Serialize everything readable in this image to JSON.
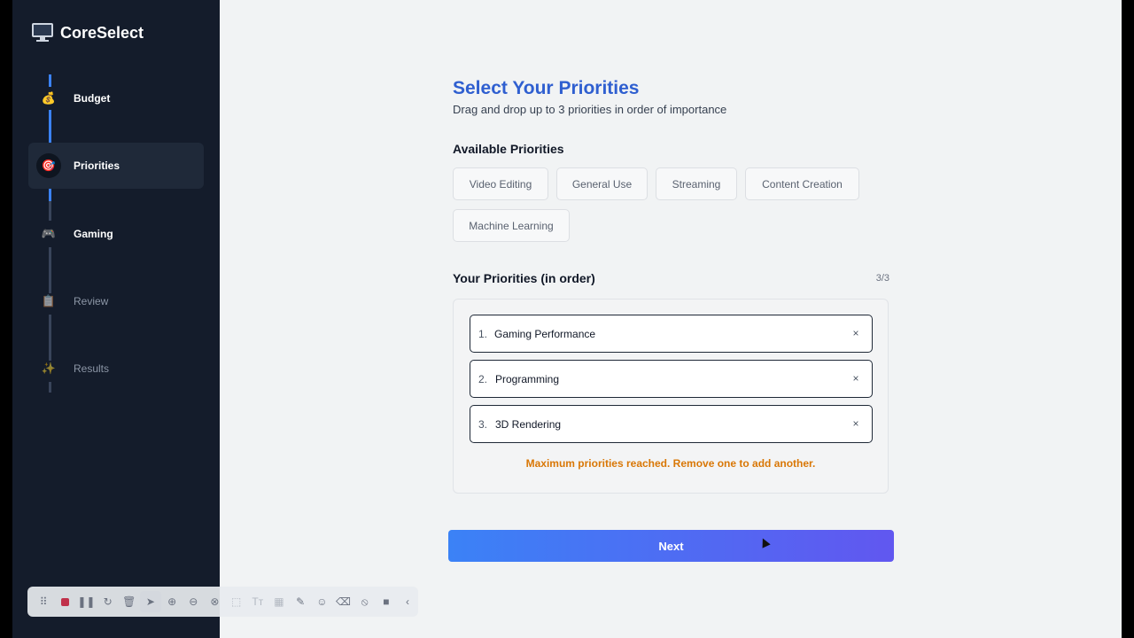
{
  "app": {
    "title": "CoreSelect",
    "icon": "monitor-icon"
  },
  "sidebar": {
    "steps": [
      {
        "label": "Budget",
        "icon": "money-bag-icon",
        "glyph": "💰",
        "state": "done"
      },
      {
        "label": "Priorities",
        "icon": "target-icon",
        "glyph": "🎯",
        "state": "current"
      },
      {
        "label": "Gaming",
        "icon": "gamepad-icon",
        "glyph": "🎮",
        "state": "upcoming"
      },
      {
        "label": "Review",
        "icon": "clipboard-icon",
        "glyph": "📋",
        "state": "upcoming"
      },
      {
        "label": "Results",
        "icon": "sparkles-icon",
        "glyph": "✨",
        "state": "upcoming"
      }
    ]
  },
  "main": {
    "title": "Select Your Priorities",
    "subtitle": "Drag and drop up to 3 priorities in order of importance",
    "available_heading": "Available Priorities",
    "available": [
      "Video Editing",
      "General Use",
      "Streaming",
      "Content Creation",
      "Machine Learning"
    ],
    "selected_heading": "Your Priorities (in order)",
    "count": "3/3",
    "selected": [
      {
        "num": "1.",
        "name": "Gaming Performance",
        "remove": "×"
      },
      {
        "num": "2.",
        "name": "Programming",
        "remove": "×"
      },
      {
        "num": "3.",
        "name": "3D Rendering",
        "remove": "×"
      }
    ],
    "warning": "Maximum priorities reached. Remove one to add another.",
    "next_label": "Next"
  },
  "colors": {
    "sidebar_bg": "#141c2b",
    "accent": "#3b82f6",
    "title": "#2f5fd0",
    "warning": "#d97706",
    "button_gradient_end": "#6157f0"
  },
  "toolbar": {
    "icons": [
      "drag-handle-icon",
      "record-stop-icon",
      "pause-icon",
      "restart-icon",
      "trash-icon",
      "pointer-icon",
      "zoom-in-icon",
      "zoom-out-icon",
      "crop-zoom-icon",
      "select-region-icon",
      "text-icon",
      "blur-icon",
      "magic-pen-icon",
      "emoji-icon",
      "eraser-icon",
      "pin-off-icon",
      "camera-icon",
      "collapse-icon"
    ]
  }
}
